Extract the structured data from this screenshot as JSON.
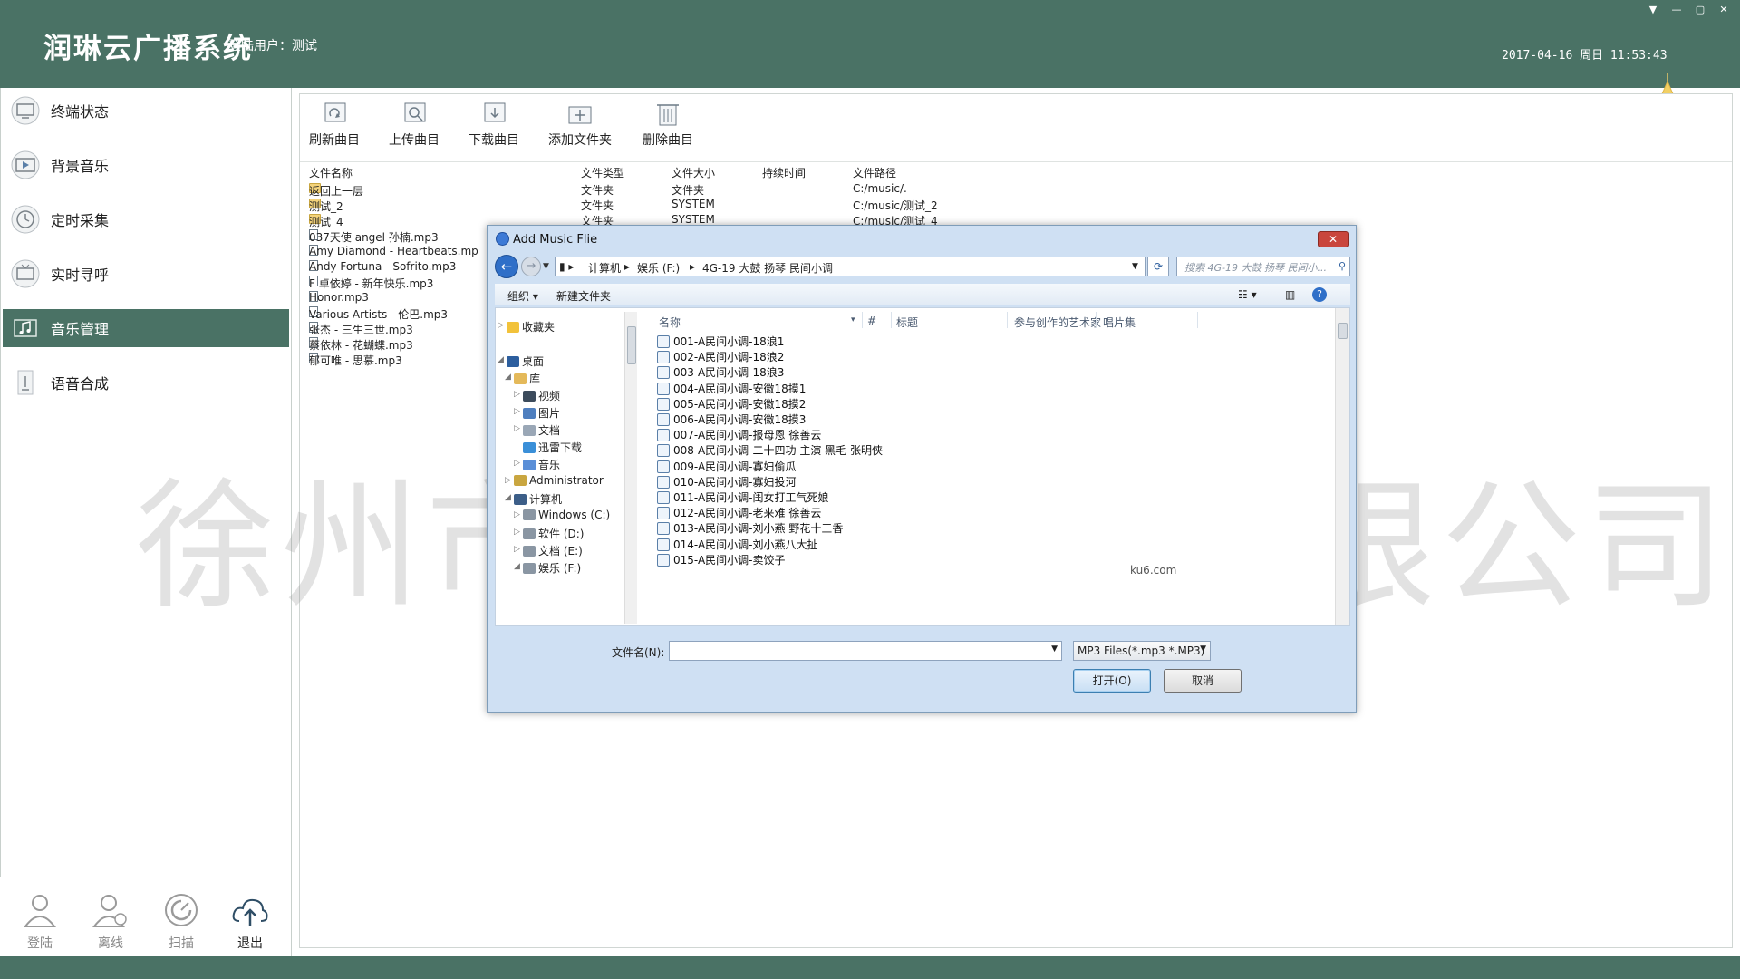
{
  "header": {
    "logo": "润琳云广播系统",
    "login_user": "登陆用户：测试",
    "datetime": "2017-04-16 周日 11:53:43"
  },
  "sidebar": {
    "items": [
      {
        "label": "终端状态",
        "icon": "monitor-icon"
      },
      {
        "label": "背景音乐",
        "icon": "video-play-icon"
      },
      {
        "label": "定时采集",
        "icon": "clock-icon"
      },
      {
        "label": "实时寻呼",
        "icon": "tv-icon"
      },
      {
        "label": "音乐管理",
        "icon": "music-note-icon",
        "active": true
      },
      {
        "label": "语音合成",
        "icon": "microphone-icon"
      }
    ]
  },
  "bottom": {
    "login": "登陆",
    "offline": "离线",
    "scan": "扫描",
    "exit": "退出"
  },
  "toolbar": {
    "refresh": "刷新曲目",
    "upload": "上传曲目",
    "download": "下载曲目",
    "add_folder": "添加文件夹",
    "delete": "删除曲目"
  },
  "table": {
    "headers": [
      "文件名称",
      "文件类型",
      "文件大小",
      "持续时间",
      "文件路径"
    ],
    "rows": [
      {
        "name": "返回上一层",
        "type": "文件夹",
        "size": "文件夹",
        "path": "C:/music/.",
        "kind": "folder"
      },
      {
        "name": "测试_2",
        "type": "文件夹",
        "size": "SYSTEM",
        "path": "C:/music/测试_2",
        "kind": "folder"
      },
      {
        "name": "测试_4",
        "type": "文件夹",
        "size": "SYSTEM",
        "path": "C:/music/测试_4",
        "kind": "folder"
      },
      {
        "name": "037天使 angel 孙楠.mp3",
        "kind": "file"
      },
      {
        "name": "Amy Diamond - Heartbeats.mp",
        "kind": "file"
      },
      {
        "name": "Andy Fortuna - Sofrito.mp3",
        "kind": "file"
      },
      {
        "name": "F 卓依婷 - 新年快乐.mp3",
        "kind": "file"
      },
      {
        "name": "Honor.mp3",
        "kind": "file"
      },
      {
        "name": "Various Artists - 伦巴.mp3",
        "kind": "file"
      },
      {
        "name": "张杰 - 三生三世.mp3",
        "kind": "file"
      },
      {
        "name": "蔡依林 - 花蝴蝶.mp3",
        "kind": "file"
      },
      {
        "name": "郁可唯 - 思慕.mp3",
        "kind": "file"
      }
    ]
  },
  "dialog": {
    "title": "Add Music Flie",
    "close": "✕",
    "breadcrumb": [
      "计算机",
      "娱乐 (F:)",
      "4G-19 大鼓 扬琴 民间小调"
    ],
    "search_placeholder": "搜索 4G-19 大鼓 扬琴 民间小...",
    "organize": "组织 ▾",
    "new_folder": "新建文件夹",
    "tree": [
      {
        "label": "收藏夹",
        "icon": "star-icon"
      },
      {
        "label": "桌面",
        "icon": "desktop-icon"
      },
      {
        "label": "库",
        "icon": "library-icon"
      },
      {
        "label": "视频",
        "icon": "video-icon"
      },
      {
        "label": "图片",
        "icon": "picture-icon"
      },
      {
        "label": "文档",
        "icon": "document-icon"
      },
      {
        "label": "迅雷下载",
        "icon": "download-icon"
      },
      {
        "label": "音乐",
        "icon": "music-icon"
      },
      {
        "label": "Administrator",
        "icon": "user-icon"
      },
      {
        "label": "计算机",
        "icon": "computer-icon"
      },
      {
        "label": "Windows (C:)",
        "icon": "drive-icon"
      },
      {
        "label": "软件 (D:)",
        "icon": "drive-icon"
      },
      {
        "label": "文档 (E:)",
        "icon": "drive-icon"
      },
      {
        "label": "娱乐 (F:)",
        "icon": "drive-icon"
      }
    ],
    "columns": [
      "名称",
      "#",
      "标题",
      "参与创作的艺术家",
      "唱片集"
    ],
    "files": [
      "001-A民间小调-18浪1",
      "002-A民间小调-18浪2",
      "003-A民间小调-18浪3",
      "004-A民间小调-安徽18摸1",
      "005-A民间小调-安徽18摸2",
      "006-A民间小调-安徽18摸3",
      "007-A民间小调-报母恩  徐善云",
      "008-A民间小调-二十四功 主演 黑毛 张明侠",
      "009-A民间小调-寡妇偷瓜",
      "010-A民间小调-寡妇投河",
      "011-A民间小调-闺女打工气死娘",
      "012-A民间小调-老来难  徐善云",
      "013-A民间小调-刘小燕 野花十三香",
      "014-A民间小调-刘小燕八大扯",
      "015-A民间小调-卖饺子"
    ],
    "ku6": "ku6.com",
    "filename_label": "文件名(N):",
    "filename_value": "",
    "filetype": "MP3 Files(*.mp3 *.MP3)",
    "open": "打开(O)",
    "cancel": "取消"
  },
  "watermark": "徐州市润琳商贸有限公司",
  "colors": {
    "brand": "#4a7265",
    "dialog_bg": "#cfe0f3"
  }
}
